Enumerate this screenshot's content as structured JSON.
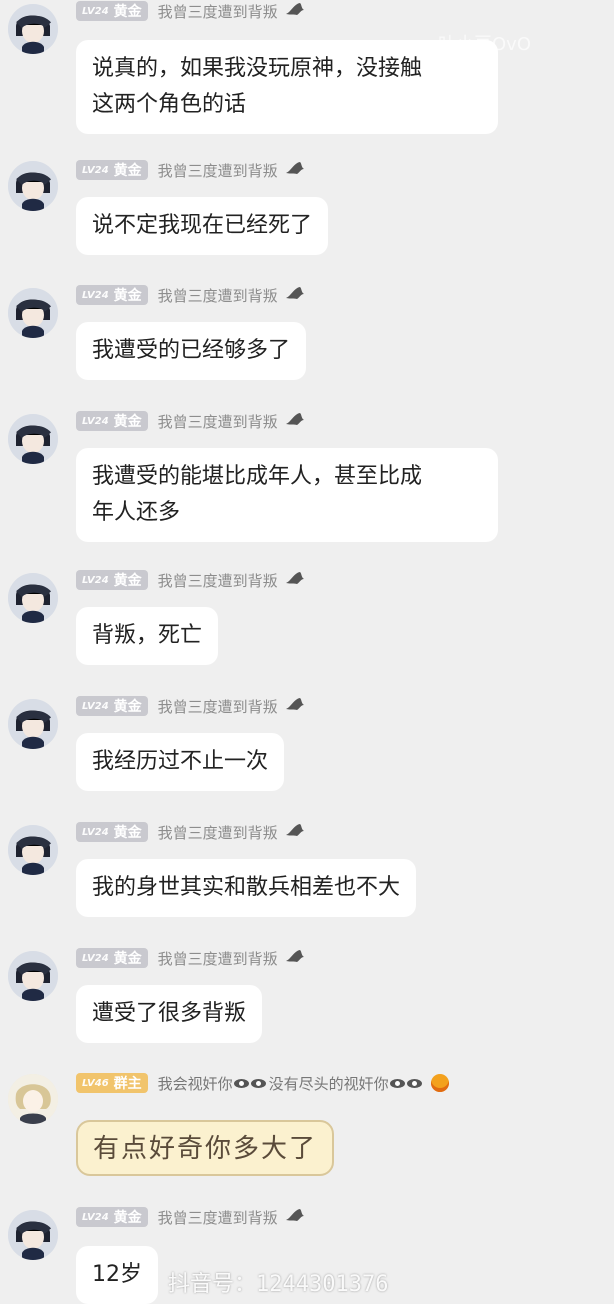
{
  "colors": {
    "background": "#efefef",
    "bubble": "#ffffff",
    "badge": "#c9c9cf",
    "owner_badge": "#f1c46c"
  },
  "messages": [
    {
      "level": "LV24",
      "rank": "黄金",
      "nickname": "我曾三度遭到背叛",
      "lines": [
        "说真的，如果我没玩原神，没接触",
        "这两个角色的话"
      ]
    },
    {
      "level": "LV24",
      "rank": "黄金",
      "nickname": "我曾三度遭到背叛",
      "lines": [
        "说不定我现在已经死了"
      ]
    },
    {
      "level": "LV24",
      "rank": "黄金",
      "nickname": "我曾三度遭到背叛",
      "lines": [
        "我遭受的已经够多了"
      ]
    },
    {
      "level": "LV24",
      "rank": "黄金",
      "nickname": "我曾三度遭到背叛",
      "lines": [
        "我遭受的能堪比成年人，甚至比成",
        "年人还多"
      ]
    },
    {
      "level": "LV24",
      "rank": "黄金",
      "nickname": "我曾三度遭到背叛",
      "lines": [
        "背叛，死亡"
      ]
    },
    {
      "level": "LV24",
      "rank": "黄金",
      "nickname": "我曾三度遭到背叛",
      "lines": [
        "我经历过不止一次"
      ]
    },
    {
      "level": "LV24",
      "rank": "黄金",
      "nickname": "我曾三度遭到背叛",
      "lines": [
        "我的身世其实和散兵相差也不大"
      ]
    },
    {
      "level": "LV24",
      "rank": "黄金",
      "nickname": "我曾三度遭到背叛",
      "lines": [
        "遭受了很多背叛"
      ]
    },
    {
      "level": "LV46",
      "rank": "群主",
      "nickname": "我会视奸你",
      "nickname_suffix": "没有尽头的视奸你",
      "sticker_text": "有点好奇你多大了"
    },
    {
      "level": "LV24",
      "rank": "黄金",
      "nickname": "我曾三度遭到背叛",
      "lines": [
        "12岁"
      ]
    }
  ],
  "watermark": "抖音号：1244301376",
  "top_watermark": "叶小豆OvO",
  "icons": {
    "avatar": "anime-avatar-icon",
    "title": "dragon-title-icon",
    "eye": "eye-emoji-icon",
    "fire": "fire-icon"
  }
}
